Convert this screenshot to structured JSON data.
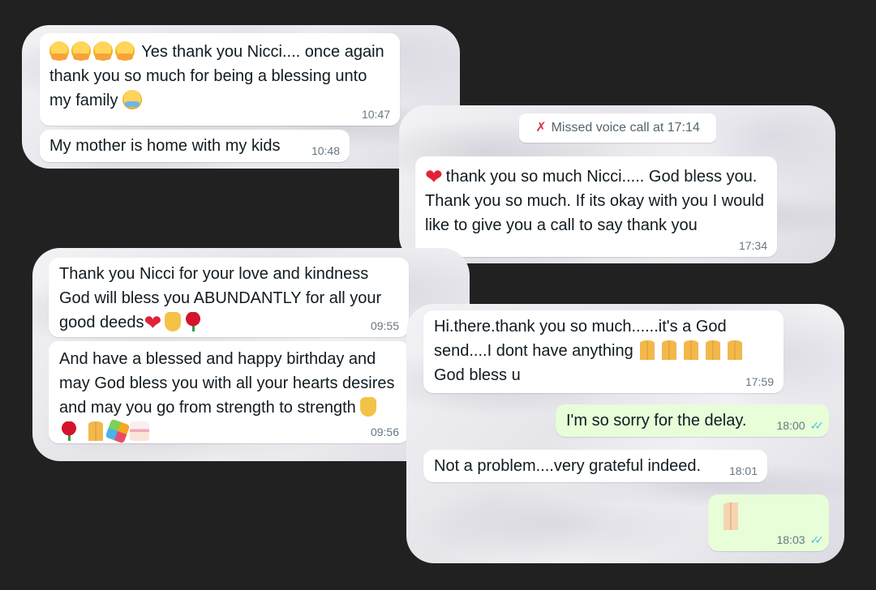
{
  "screenshot1": {
    "messages": [
      {
        "text": "Yes thank you Nicci.... once again thank you so much for being a blessing unto my family",
        "time": "10:47",
        "direction": "in"
      },
      {
        "text": "My mother is home with my kids",
        "time": "10:48",
        "direction": "in"
      }
    ],
    "icons": [
      "hugging-face-emoji",
      "hugging-face-emoji",
      "hugging-face-emoji",
      "hugging-face-emoji",
      "crying-face-emoji"
    ]
  },
  "screenshot2": {
    "system_notice": "Missed voice call at 17:14",
    "messages": [
      {
        "text": "thank you so much Nicci..... God bless you. Thank you so much. If its okay with you I would like to give you a call to say thank you",
        "time": "17:34",
        "direction": "in"
      }
    ],
    "icons": [
      "missed-call-icon",
      "red-heart-emoji"
    ]
  },
  "screenshot3": {
    "messages": [
      {
        "text": "Thank you Nicci for your love and kindness God will bless you ABUNDANTLY for all your good deeds",
        "time": "09:55",
        "direction": "in"
      },
      {
        "text": "And have a blessed and happy birthday and may God bless you with all your hearts desires and may you go from strength to strength",
        "time": "09:56",
        "direction": "in"
      }
    ],
    "icons": [
      "red-heart-emoji",
      "raised-hands-emoji",
      "rose-emoji",
      "raised-hands-emoji",
      "rose-emoji",
      "folded-hands-emoji",
      "party-popper-emoji",
      "birthday-cake-emoji"
    ]
  },
  "screenshot4": {
    "messages": [
      {
        "text": "Hi.there.thank you so much......it's a God send....I dont have anything",
        "text2": "God bless u",
        "time": "17:59",
        "direction": "in"
      },
      {
        "text": "I'm so sorry for the delay.",
        "time": "18:00",
        "direction": "out",
        "status": "read"
      },
      {
        "text": "Not a problem....very grateful indeed.",
        "time": "18:01",
        "direction": "in"
      },
      {
        "text": "",
        "time": "18:03",
        "direction": "out",
        "status": "read"
      }
    ],
    "icons": [
      "folded-hands-emoji",
      "double-check-icon"
    ]
  },
  "colors": {
    "background": "#212121",
    "incoming_bubble": "#ffffff",
    "outgoing_bubble": "#e7fed8",
    "timestamp": "#667781",
    "read_ticks": "#53bdeb",
    "missed_call": "#e0314a"
  }
}
